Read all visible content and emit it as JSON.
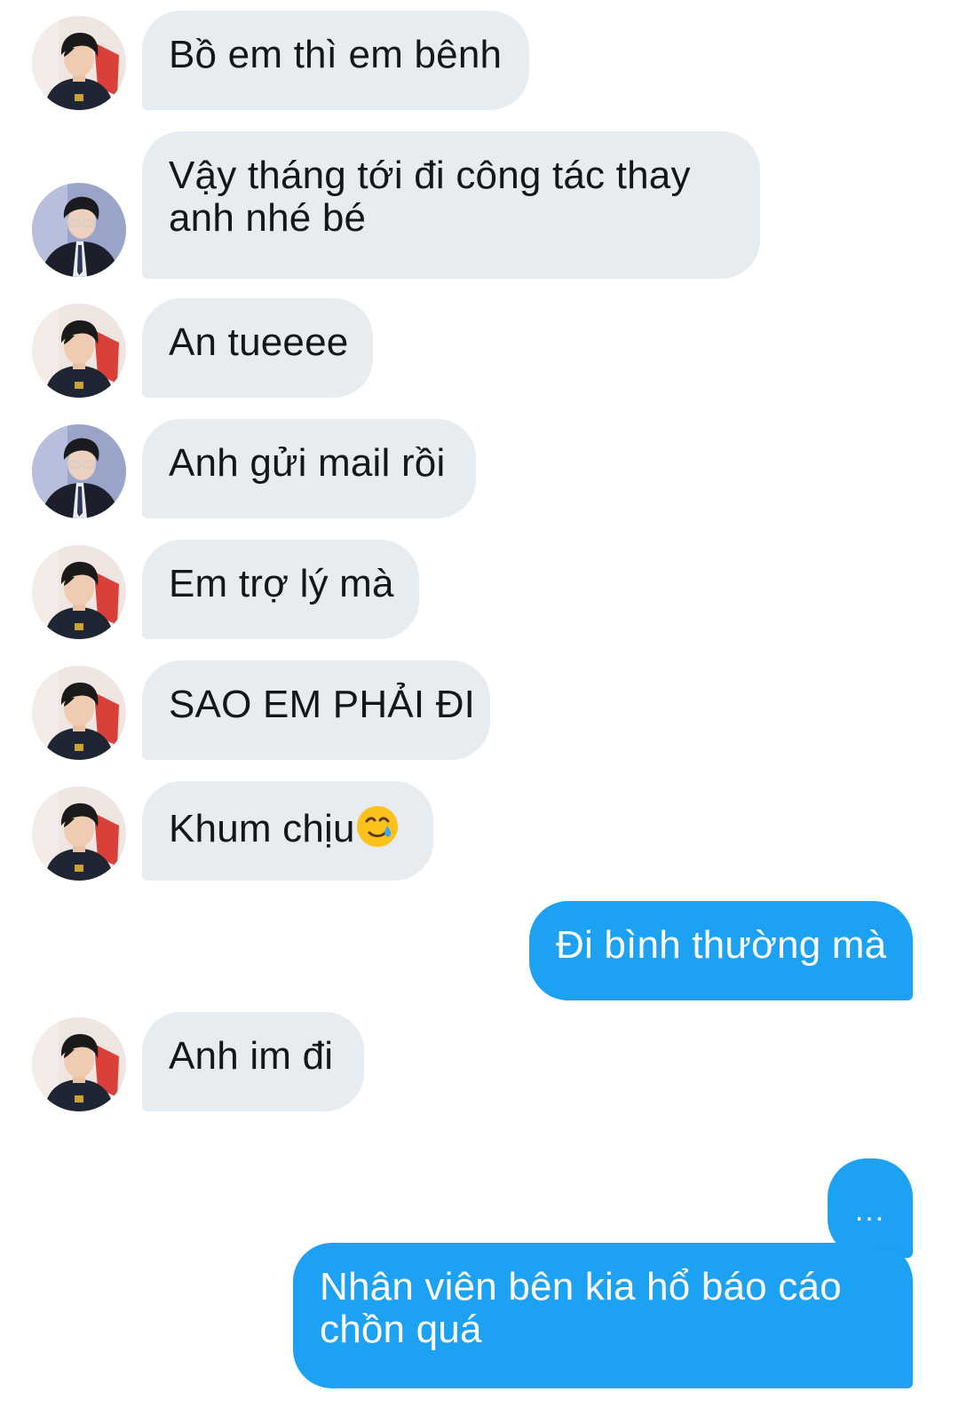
{
  "conversation": {
    "messages": [
      {
        "sender": "other",
        "avatar": "avatar-boy-hoodie",
        "text": "Bồ em thì em bênh"
      },
      {
        "sender": "other",
        "avatar": "avatar-man-suit",
        "text": "Vậy tháng tới đi công tác thay anh nhé bé"
      },
      {
        "sender": "other",
        "avatar": "avatar-boy-hoodie",
        "text": "An tueeee"
      },
      {
        "sender": "other",
        "avatar": "avatar-man-suit",
        "text": "Anh gửi mail rồi"
      },
      {
        "sender": "other",
        "avatar": "avatar-boy-hoodie",
        "text": "Em trợ lý mà"
      },
      {
        "sender": "other",
        "avatar": "avatar-boy-hoodie",
        "text": "SAO EM PHẢI ĐI"
      },
      {
        "sender": "other",
        "avatar": "avatar-boy-hoodie",
        "text": "Khum chịu",
        "emoji": "smiling-face-with-tear-emoji"
      },
      {
        "sender": "me",
        "text": "Đi bình thường mà"
      },
      {
        "sender": "other",
        "avatar": "avatar-boy-hoodie",
        "text": "Anh im đi"
      },
      {
        "sender": "me",
        "text": "..."
      },
      {
        "sender": "me",
        "text": "Nhân viên bên kia hổ báo cáo chồn quá"
      }
    ]
  },
  "colors": {
    "incoming_bubble": "#e6ecf0",
    "outgoing_bubble": "#1da1f2",
    "incoming_text": "#14171a",
    "outgoing_text": "#ffffff"
  }
}
